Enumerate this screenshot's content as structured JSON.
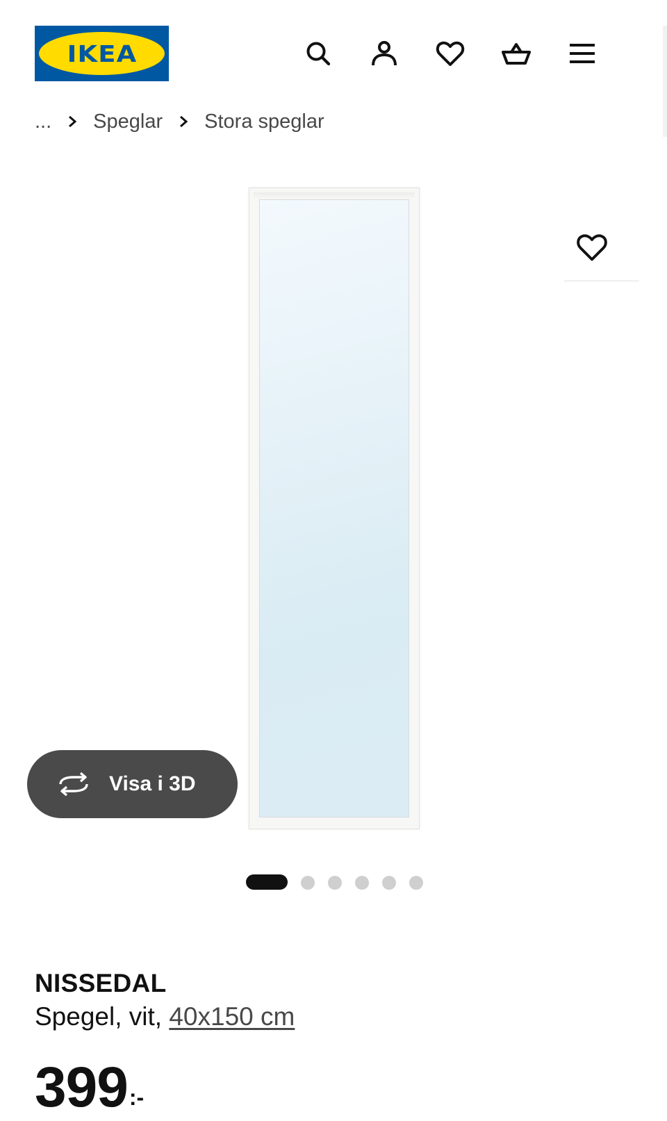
{
  "header": {
    "logo_text": "IKEA",
    "brand_colors": {
      "blue": "#0058a3",
      "yellow": "#ffdb00"
    },
    "icons": [
      "search-icon",
      "account-icon",
      "heart-icon",
      "basket-icon",
      "menu-icon"
    ]
  },
  "breadcrumb": {
    "ellipsis": "...",
    "items": [
      "Speglar",
      "Stora speglar"
    ]
  },
  "gallery": {
    "view_3d_label": "Visa i 3D",
    "image_count": 6,
    "active_index": 0
  },
  "product": {
    "name": "NISSEDAL",
    "description_prefix": "Spegel, vit, ",
    "size_link": "40x150 cm",
    "price_integer": "399",
    "price_suffix": ":-"
  }
}
